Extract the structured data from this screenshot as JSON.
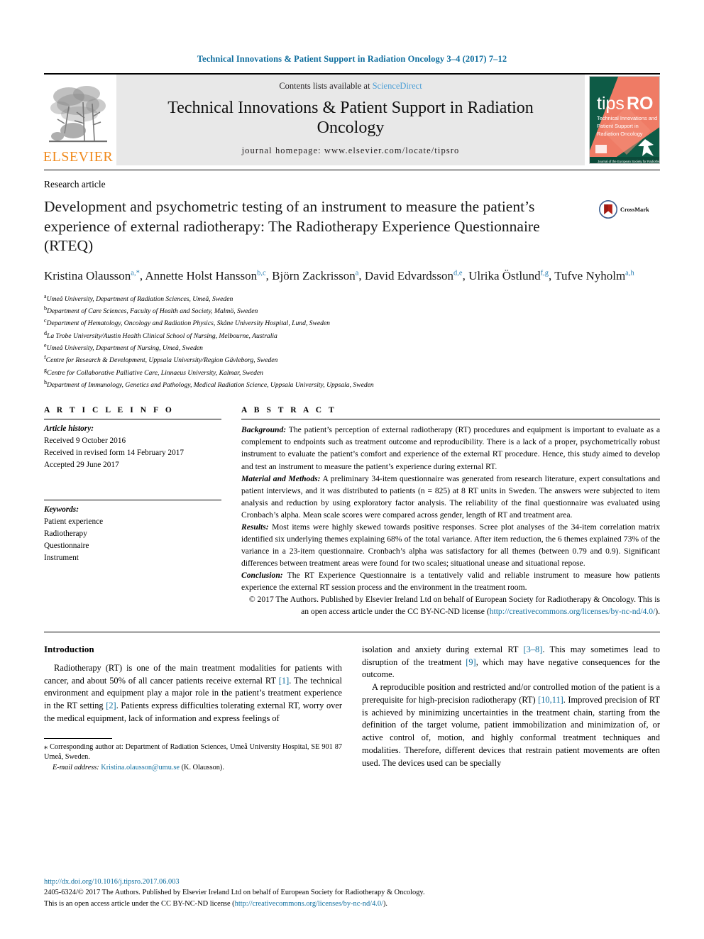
{
  "running_head": "Technical Innovations & Patient Support in Radiation Oncology 3–4 (2017) 7–12",
  "masthead": {
    "contents_prefix": "Contents lists available at ",
    "sciencedirect": "ScienceDirect",
    "journal_title": "Technical Innovations & Patient Support in Radiation Oncology",
    "homepage": "journal homepage: www.elsevier.com/locate/tipsro",
    "elsevier_wordmark": "ELSEVIER",
    "cover": {
      "brand_tips": "tips",
      "brand_ro": "RO",
      "subtitle_line1": "Technical Innovations and",
      "subtitle_line2": "Patient Support in",
      "subtitle_line3": "Radiation Oncology",
      "footer": "Journal of the European Society for Radiotherapy and Oncology"
    }
  },
  "article": {
    "type": "Research article",
    "title": "Development and psychometric testing of an instrument to measure the patient’s experience of external radiotherapy: The Radiotherapy Experience Questionnaire (RTEQ)",
    "crossmark_label": "CrossMark",
    "authors_line1_parts": [
      {
        "name": "Kristina Olausson",
        "sup": "a,*"
      },
      {
        "name": "Annette Holst Hansson",
        "sup": "b,c"
      },
      {
        "name": "Björn Zackrisson",
        "sup": "a"
      },
      {
        "name": "David Edvardsson",
        "sup": "d,e"
      },
      {
        "name": "Ulrika Östlund",
        "sup": "f,g"
      },
      {
        "name": "Tufve Nyholm",
        "sup": "a,h"
      }
    ],
    "affiliations": [
      {
        "key": "a",
        "text": "Umeå University, Department of Radiation Sciences, Umeå, Sweden"
      },
      {
        "key": "b",
        "text": "Department of Care Sciences, Faculty of Health and Society, Malmö, Sweden"
      },
      {
        "key": "c",
        "text": "Department of Hematology, Oncology and Radiation Physics, Skåne University Hospital, Lund, Sweden"
      },
      {
        "key": "d",
        "text": "La Trobe University/Austin Health Clinical School of Nursing, Melbourne, Australia"
      },
      {
        "key": "e",
        "text": "Umeå University, Department of Nursing, Umeå, Sweden"
      },
      {
        "key": "f",
        "text": "Centre for Research & Development, Uppsala University/Region Gävleborg, Sweden"
      },
      {
        "key": "g",
        "text": "Centre for Collaborative Palliative Care, Linnaeus University, Kalmar, Sweden"
      },
      {
        "key": "h",
        "text": "Department of Immunology, Genetics and Pathology, Medical Radiation Science, Uppsala University, Uppsala, Sweden"
      }
    ]
  },
  "article_info": {
    "heading": "A R T I C L E  I N F O",
    "history_label": "Article history:",
    "received": "Received 9 October 2016",
    "revised": "Received in revised form 14 February 2017",
    "accepted": "Accepted 29 June 2017",
    "keywords_label": "Keywords:",
    "keywords": [
      "Patient experience",
      "Radiotherapy",
      "Questionnaire",
      "Instrument"
    ]
  },
  "abstract": {
    "heading": "A B S T R A C T",
    "background_label": "Background:",
    "background_text": " The patient’s perception of external radiotherapy (RT) procedures and equipment is important to evaluate as a complement to endpoints such as treatment outcome and reproducibility. There is a lack of a proper, psychometrically robust instrument to evaluate the patient’s comfort and experience of the external RT procedure. Hence, this study aimed to develop and test an instrument to measure the patient’s experience during external RT.",
    "methods_label": "Material and Methods:",
    "methods_text": " A preliminary 34-item questionnaire was generated from research literature, expert consultations and patient interviews, and it was distributed to patients (n = 825) at 8 RT units in Sweden. The answers were subjected to item analysis and reduction by using exploratory factor analysis. The reliability of the final questionnaire was evaluated using Cronbach’s alpha. Mean scale scores were compared across gender, length of RT and treatment area.",
    "results_label": "Results:",
    "results_text": " Most items were highly skewed towards positive responses. Scree plot analyses of the 34-item correlation matrix identified six underlying themes explaining 68% of the total variance. After item reduction, the 6 themes explained 73% of the variance in a 23-item questionnaire. Cronbach’s alpha was satisfactory for all themes (between 0.79 and 0.9). Significant differences between treatment areas were found for two scales; situational unease and situational repose.",
    "conclusion_label": "Conclusion:",
    "conclusion_text": " The RT Experience Questionnaire is a tentatively valid and reliable instrument to measure how patients experience the external RT session process and the environment in the treatment room.",
    "copyright_text": "© 2017 The Authors. Published by Elsevier Ireland Ltd on behalf of European Society for Radiotherapy & Oncology. This is an open access article under the CC BY-NC-ND license (",
    "copyright_link": "http://creativecommons.org/licenses/by-nc-nd/4.0/",
    "copyright_tail": ")."
  },
  "intro": {
    "heading": "Introduction",
    "left_p1_a": "Radiotherapy (RT) is one of the main treatment modalities for patients with cancer, and about 50% of all cancer patients receive external RT ",
    "left_p1_ref1": "[1]",
    "left_p1_b": ". The technical environment and equipment play a major role in the patient’s treatment experience in the RT setting ",
    "left_p1_ref2": "[2]",
    "left_p1_c": ". Patients express difficulties tolerating external RT, worry over the medical equipment, lack of information and express feelings of",
    "right_p1_a": "isolation and anxiety during external RT ",
    "right_p1_ref1": "[3–8]",
    "right_p1_b": ". This may sometimes lead to disruption of the treatment ",
    "right_p1_ref2": "[9]",
    "right_p1_c": ", which may have negative consequences for the outcome.",
    "right_p2_a": "A reproducible position and restricted and/or controlled motion of the patient is a prerequisite for high-precision radiotherapy (RT) ",
    "right_p2_ref1": "[10,11]",
    "right_p2_b": ". Improved precision of RT is achieved by minimizing uncertainties in the treatment chain, starting from the definition of the target volume, patient immobilization and minimization of, or active control of, motion, and highly conformal treatment techniques and modalities. Therefore, different devices that restrain patient movements are often used. The devices used can be specially"
  },
  "footnotes": {
    "corresponding_symbol": "⁎",
    "corresponding_text": " Corresponding author at: Department of Radiation Sciences, Umeå University Hospital, SE 901 87 Umeå, Sweden.",
    "email_label": "E-mail address:",
    "email": "Kristina.olausson@umu.se",
    "email_tail": " (K. Olausson)."
  },
  "page_footer": {
    "doi": "http://dx.doi.org/10.1016/j.tipsro.2017.06.003",
    "line1": "2405-6324/© 2017 The Authors. Published by Elsevier Ireland Ltd on behalf of European Society for Radiotherapy & Oncology.",
    "line2_a": "This is an open access article under the CC BY-NC-ND license (",
    "line2_link": "http://creativecommons.org/licenses/by-nc-nd/4.0/",
    "line2_b": ")."
  },
  "colors": {
    "link_blue": "#0f6e9e",
    "sciencedirect_blue": "#4d9fd6",
    "elsevier_orange": "#f08a1d",
    "cover_green": "#0e5b46",
    "cover_coral": "#ef7b65",
    "crossmark_red": "#b32017"
  }
}
